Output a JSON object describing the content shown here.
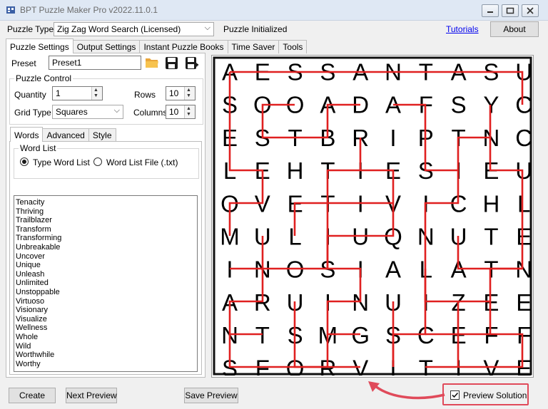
{
  "window": {
    "title": "BPT Puzzle Maker Pro v2022.11.0.1"
  },
  "toolbar": {
    "puzzle_type_label": "Puzzle Type",
    "puzzle_type_value": "Zig Zag Word Search (Licensed)",
    "status": "Puzzle Initialized",
    "tutorials_link": "Tutorials",
    "about_button": "About"
  },
  "main_tabs": [
    "Puzzle Settings",
    "Output Settings",
    "Instant Puzzle Books",
    "Time Saver",
    "Tools"
  ],
  "preset": {
    "label": "Preset",
    "value": "Preset1"
  },
  "puzzle_control": {
    "legend": "Puzzle Control",
    "quantity_label": "Quantity",
    "quantity_value": "1",
    "rows_label": "Rows",
    "rows_value": "10",
    "grid_type_label": "Grid Type",
    "grid_type_value": "Squares",
    "columns_label": "Columns",
    "columns_value": "10"
  },
  "sub_tabs": [
    "Words",
    "Advanced",
    "Style"
  ],
  "word_list": {
    "legend": "Word List",
    "option_type": "Type Word List",
    "option_file": "Word List File (.txt)",
    "selected": "Type Word List",
    "words": [
      "Tenacity",
      "Thriving",
      "Trailblazer",
      "Transform",
      "Transforming",
      "Unbreakable",
      "Uncover",
      "Unique",
      "Unleash",
      "Unlimited",
      "Unstoppable",
      "Virtuoso",
      "Visionary",
      "Visualize",
      "Wellness",
      "Whole",
      "Wild",
      "Worthwhile",
      "Worthy"
    ]
  },
  "puzzle": {
    "grid": [
      [
        "A",
        "E",
        "S",
        "S",
        "A",
        "N",
        "T",
        "A",
        "S",
        "U"
      ],
      [
        "S",
        "O",
        "O",
        "A",
        "D",
        "A",
        "F",
        "S",
        "Y",
        "C"
      ],
      [
        "E",
        "S",
        "T",
        "B",
        "R",
        "I",
        "P",
        "T",
        "N",
        "C"
      ],
      [
        "L",
        "E",
        "H",
        "T",
        "I",
        "E",
        "S",
        "I",
        "E",
        "U"
      ],
      [
        "O",
        "V",
        "E",
        "T",
        "I",
        "V",
        "I",
        "C",
        "H",
        "L"
      ],
      [
        "M",
        "U",
        "L",
        "I",
        "U",
        "Q",
        "N",
        "U",
        "T",
        "E"
      ],
      [
        "I",
        "N",
        "O",
        "S",
        "I",
        "A",
        "L",
        "A",
        "T",
        "N"
      ],
      [
        "A",
        "R",
        "U",
        "I",
        "N",
        "U",
        "I",
        "Z",
        "E",
        "E"
      ],
      [
        "N",
        "T",
        "S",
        "M",
        "G",
        "S",
        "C",
        "E",
        "F",
        "F"
      ],
      [
        "S",
        "F",
        "O",
        "R",
        "V",
        "I",
        "T",
        "I",
        "V",
        "E"
      ]
    ],
    "solution_color": "#e02020"
  },
  "bottom": {
    "create_button": "Create",
    "next_preview_button": "Next Preview",
    "save_preview_button": "Save Preview",
    "preview_solution_label": "Preview Solution",
    "preview_solution_checked": true
  },
  "annotation_color": "#e04a5a"
}
